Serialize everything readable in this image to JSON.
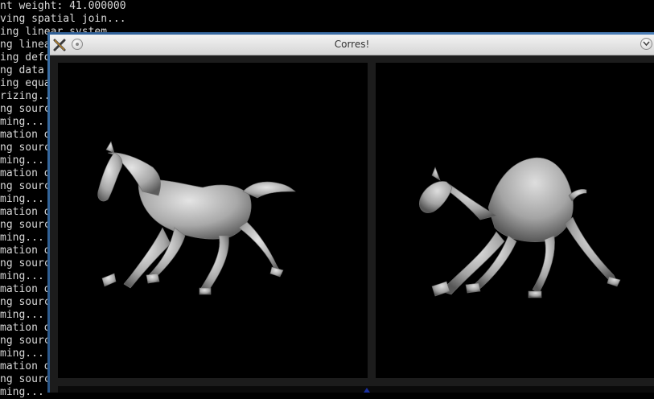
{
  "terminal": {
    "lines": [
      "nt weight: 41.000000",
      "ving spatial join...",
      "ing linear system...",
      "ng linear system...",
      "ing defo",
      "ng data",
      "ing equa",
      "rizing...",
      "ng sourc",
      "ming...",
      "mation o",
      "ng sourc",
      "ming...",
      "mation o",
      "ng sourc",
      "ming...",
      "mation o",
      "ng sourc",
      "ming...",
      "mation o",
      "ng sourc",
      "ming...",
      "mation o",
      "ng sourc",
      "ming...",
      "mation o",
      "ng sourc",
      "ming...",
      "mation o",
      "ng sourc",
      "ming..."
    ]
  },
  "window": {
    "title": "Corres!",
    "icons": {
      "app": "app-x-icon",
      "minimize": "minimize-circle-icon",
      "menu": "chevron-down-icon"
    },
    "views": {
      "left": {
        "subject": "horse-mesh",
        "color": "#b9b9b9"
      },
      "right": {
        "subject": "camel-mesh",
        "color": "#b0b0b0"
      }
    }
  },
  "colors": {
    "terminal_text": "#d8d8d8",
    "viewport_bg": "#000000",
    "window_frame": "#1c1c1c",
    "desktop_edge": "#3a6fa6"
  }
}
